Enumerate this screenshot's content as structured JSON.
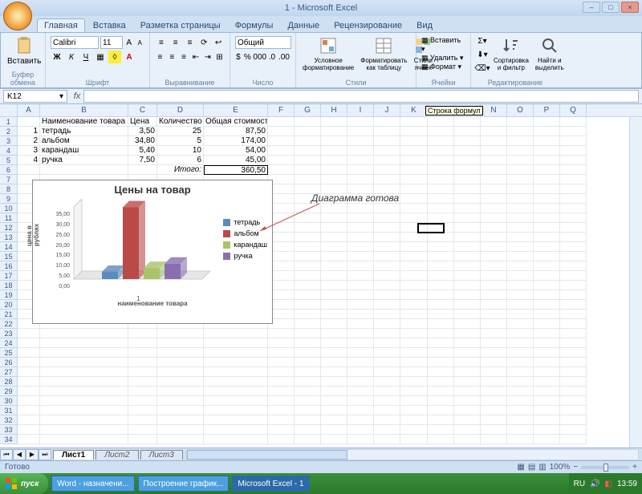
{
  "window": {
    "title": "1 - Microsoft Excel"
  },
  "tabs": [
    "Главная",
    "Вставка",
    "Разметка страницы",
    "Формулы",
    "Данные",
    "Рецензирование",
    "Вид"
  ],
  "active_tab": 0,
  "ribbon": {
    "clipboard": {
      "paste": "Вставить",
      "label": "Буфер обмена"
    },
    "font": {
      "name": "Calibri",
      "size": "11",
      "label": "Шрифт"
    },
    "align": {
      "label": "Выравнивание"
    },
    "number": {
      "format": "Общий",
      "label": "Число"
    },
    "styles": {
      "cond": "Условное форматирование",
      "table": "Форматировать как таблицу",
      "cell": "Стили ячеек",
      "label": "Стили"
    },
    "cells": {
      "insert": "Вставить",
      "delete": "Удалить",
      "format": "Формат",
      "label": "Ячейки"
    },
    "editing": {
      "sort": "Сортировка и фильтр",
      "find": "Найти и выделить",
      "label": "Редактирование"
    }
  },
  "namebox": "K12",
  "tooltip_formula": "Строка формул",
  "columns": [
    "A",
    "B",
    "C",
    "D",
    "E",
    "F",
    "G",
    "H",
    "I",
    "J",
    "K",
    "L",
    "M",
    "N",
    "O",
    "P",
    "Q"
  ],
  "headers": {
    "B": "Наименование товара",
    "C": "Цена",
    "D": "Количество",
    "E": "Общая стоимость"
  },
  "data_rows": [
    {
      "n": "1",
      "name": "тетрадь",
      "price": "3,50",
      "qty": "25",
      "total": "87,50"
    },
    {
      "n": "2",
      "name": "альбом",
      "price": "34,80",
      "qty": "5",
      "total": "174,00"
    },
    {
      "n": "3",
      "name": "карандаш",
      "price": "5,40",
      "qty": "10",
      "total": "54,00"
    },
    {
      "n": "4",
      "name": "ручка",
      "price": "7,50",
      "qty": "6",
      "total": "45,00"
    }
  ],
  "total_row": {
    "label": "Итого:",
    "value": "360,50"
  },
  "annotation": "Диаграмма готова",
  "chart_data": {
    "type": "bar",
    "title": "Цены на товар",
    "xlabel": "наименование товара",
    "ylabel": "цена в рублях",
    "categories": [
      "1"
    ],
    "series": [
      {
        "name": "тетрадь",
        "values": [
          3.5
        ],
        "color": "#5b8bbd"
      },
      {
        "name": "альбом",
        "values": [
          34.8
        ],
        "color": "#b94a48"
      },
      {
        "name": "карандаш",
        "values": [
          5.4
        ],
        "color": "#a8c36a"
      },
      {
        "name": "ручка",
        "values": [
          7.5
        ],
        "color": "#8a6fb0"
      }
    ],
    "ylim": [
      0,
      35
    ],
    "yticks": [
      0,
      5,
      10,
      15,
      20,
      25,
      30,
      35
    ],
    "ytick_labels": [
      "0,00",
      "5,00",
      "10,00",
      "15,00",
      "20,00",
      "25,00",
      "30,00",
      "35,00"
    ]
  },
  "sheet_tabs": [
    "Лист1",
    "Лист2",
    "Лист3"
  ],
  "status": "Готово",
  "zoom": "100%",
  "taskbar": {
    "start": "пуск",
    "items": [
      "Word - назначени...",
      "Построение график...",
      "Microsoft Excel - 1"
    ],
    "lang": "RU",
    "clock": "13:59"
  }
}
